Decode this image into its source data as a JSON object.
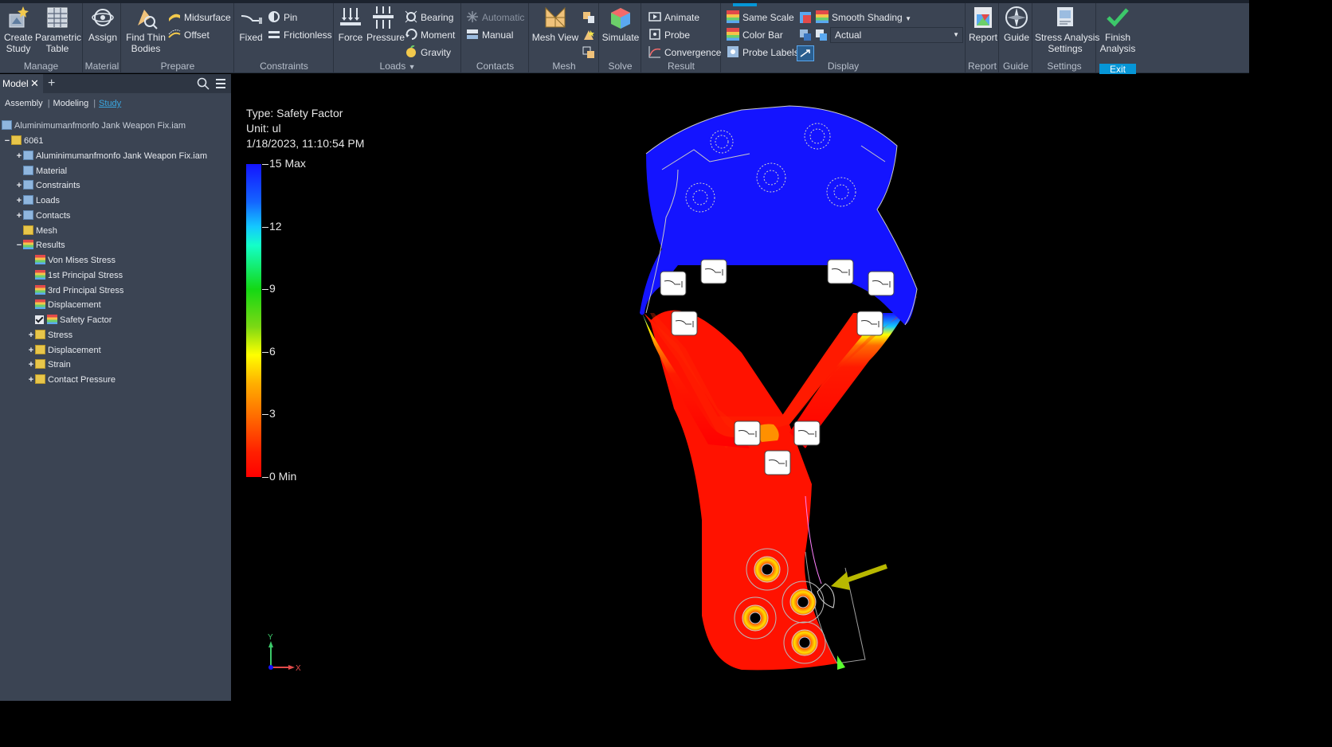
{
  "ribbon": {
    "manage": {
      "label": "Manage",
      "create_study": "Create\nStudy",
      "parametric_table": "Parametric\nTable"
    },
    "material": {
      "label": "Material",
      "assign": "Assign"
    },
    "prepare": {
      "label": "Prepare",
      "find_thin": "Find Thin\nBodies",
      "midsurface": "Midsurface",
      "offset": "Offset"
    },
    "constraints": {
      "label": "Constraints",
      "fixed": "Fixed",
      "pin": "Pin",
      "frictionless": "Frictionless"
    },
    "loads": {
      "label": "Loads",
      "force": "Force",
      "pressure": "Pressure",
      "bearing": "Bearing",
      "moment": "Moment",
      "gravity": "Gravity"
    },
    "contacts": {
      "label": "Contacts",
      "automatic": "Automatic",
      "manual": "Manual"
    },
    "mesh": {
      "label": "Mesh",
      "mesh_view": "Mesh View"
    },
    "solve": {
      "label": "Solve",
      "simulate": "Simulate"
    },
    "result": {
      "label": "Result",
      "animate": "Animate",
      "probe": "Probe",
      "convergence": "Convergence"
    },
    "display": {
      "label": "Display",
      "same_scale": "Same Scale",
      "color_bar": "Color Bar",
      "probe_labels": "Probe Labels",
      "smooth_shading": "Smooth Shading",
      "actual": "Actual"
    },
    "report": {
      "label": "Report",
      "report": "Report"
    },
    "guide": {
      "label": "Guide",
      "guide": "Guide"
    },
    "settings": {
      "label": "Settings",
      "stress_settings": "Stress Analysis\nSettings"
    },
    "exit": {
      "label": "Exit",
      "finish": "Finish\nAnalysis"
    }
  },
  "browser": {
    "tab": "Model",
    "subtabs": [
      "Assembly",
      "Modeling",
      "Study"
    ],
    "root": "Aluminimumanfmonfo Jank Weapon Fix.iam",
    "tree": [
      {
        "label": "6061",
        "level": 0,
        "exp": "−"
      },
      {
        "label": "Aluminimumanfmonfo Jank Weapon Fix.iam",
        "level": 1,
        "exp": "+"
      },
      {
        "label": "Material",
        "level": 1,
        "exp": ""
      },
      {
        "label": "Constraints",
        "level": 1,
        "exp": "+"
      },
      {
        "label": "Loads",
        "level": 1,
        "exp": "+"
      },
      {
        "label": "Contacts",
        "level": 1,
        "exp": "+"
      },
      {
        "label": "Mesh",
        "level": 1,
        "exp": ""
      },
      {
        "label": "Results",
        "level": 1,
        "exp": "−"
      },
      {
        "label": "Von Mises Stress",
        "level": 2,
        "exp": ""
      },
      {
        "label": "1st Principal Stress",
        "level": 2,
        "exp": ""
      },
      {
        "label": "3rd Principal Stress",
        "level": 2,
        "exp": ""
      },
      {
        "label": "Displacement",
        "level": 2,
        "exp": ""
      },
      {
        "label": "Safety Factor",
        "level": 2,
        "exp": ""
      },
      {
        "label": "Stress",
        "level": 2,
        "exp": "+"
      },
      {
        "label": "Displacement",
        "level": 2,
        "exp": "+"
      },
      {
        "label": "Strain",
        "level": 2,
        "exp": "+"
      },
      {
        "label": "Contact Pressure",
        "level": 2,
        "exp": "+"
      }
    ]
  },
  "viewport": {
    "type": "Type: Safety Factor",
    "unit": "Unit: ul",
    "timestamp": "1/18/2023, 11:10:54 PM",
    "colorbar": [
      "15 Max",
      "12",
      "9",
      "6",
      "3",
      "0 Min"
    ],
    "triad_y": "Y",
    "triad_x": "X"
  }
}
